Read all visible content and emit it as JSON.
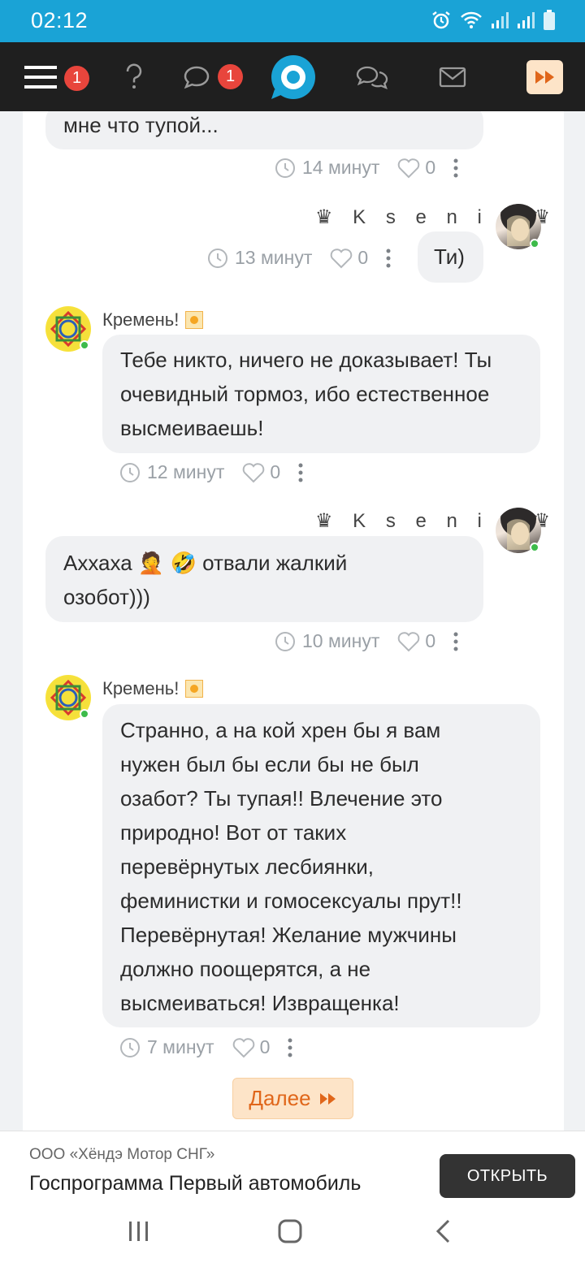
{
  "status_bar": {
    "time": "02:12"
  },
  "nav": {
    "menu_badge": "1",
    "chat_badge": "1"
  },
  "messages": [
    {
      "text": "мне что тупой...",
      "time": "14 минут",
      "likes": "0"
    },
    {
      "author": "♛ K s e n i a ♛",
      "text": "Ти)",
      "time": "13 минут",
      "likes": "0"
    },
    {
      "author": "Кремень!",
      "text_lines": [
        "Тебе никто, ничего не доказывает! Ты",
        "очевидный тормоз, ибо естественное",
        "высмеиваешь!"
      ],
      "time": "12 минут",
      "likes": "0"
    },
    {
      "author": "♛ K s e n i a ♛",
      "text_lines": [
        "Аххаха 🤦 🤣 отвали жалкий",
        "озобот)))"
      ],
      "time": "10 минут",
      "likes": "0"
    },
    {
      "author": "Кремень!",
      "text_lines": [
        "Странно, а на кой хрен бы я вам",
        "нужен был бы если бы не был",
        "озабот? Ты тупая!! Влечение это",
        "природно! Вот от таких",
        "перевёрнутых лесбиянки,",
        "феминистки и гомосексуалы прут!!",
        "Перевёрнутая! Желание мужчины",
        "должно поощерятся, а не",
        "высмеиваться! Извращенка!"
      ],
      "time": "7 минут",
      "likes": "0"
    }
  ],
  "next_button": {
    "label": "Далее"
  },
  "ad": {
    "company": "ООО «Хёндэ Мотор СНГ»",
    "headline": "Госпрограмма Первый автомобиль",
    "button": "ОТКРЫТЬ"
  },
  "colors": {
    "status_bar": "#1aa3d6",
    "nav_bg": "#1f1f1f",
    "badge": "#e8453c",
    "accent": "#e0661a",
    "online": "#3dbb4a"
  }
}
